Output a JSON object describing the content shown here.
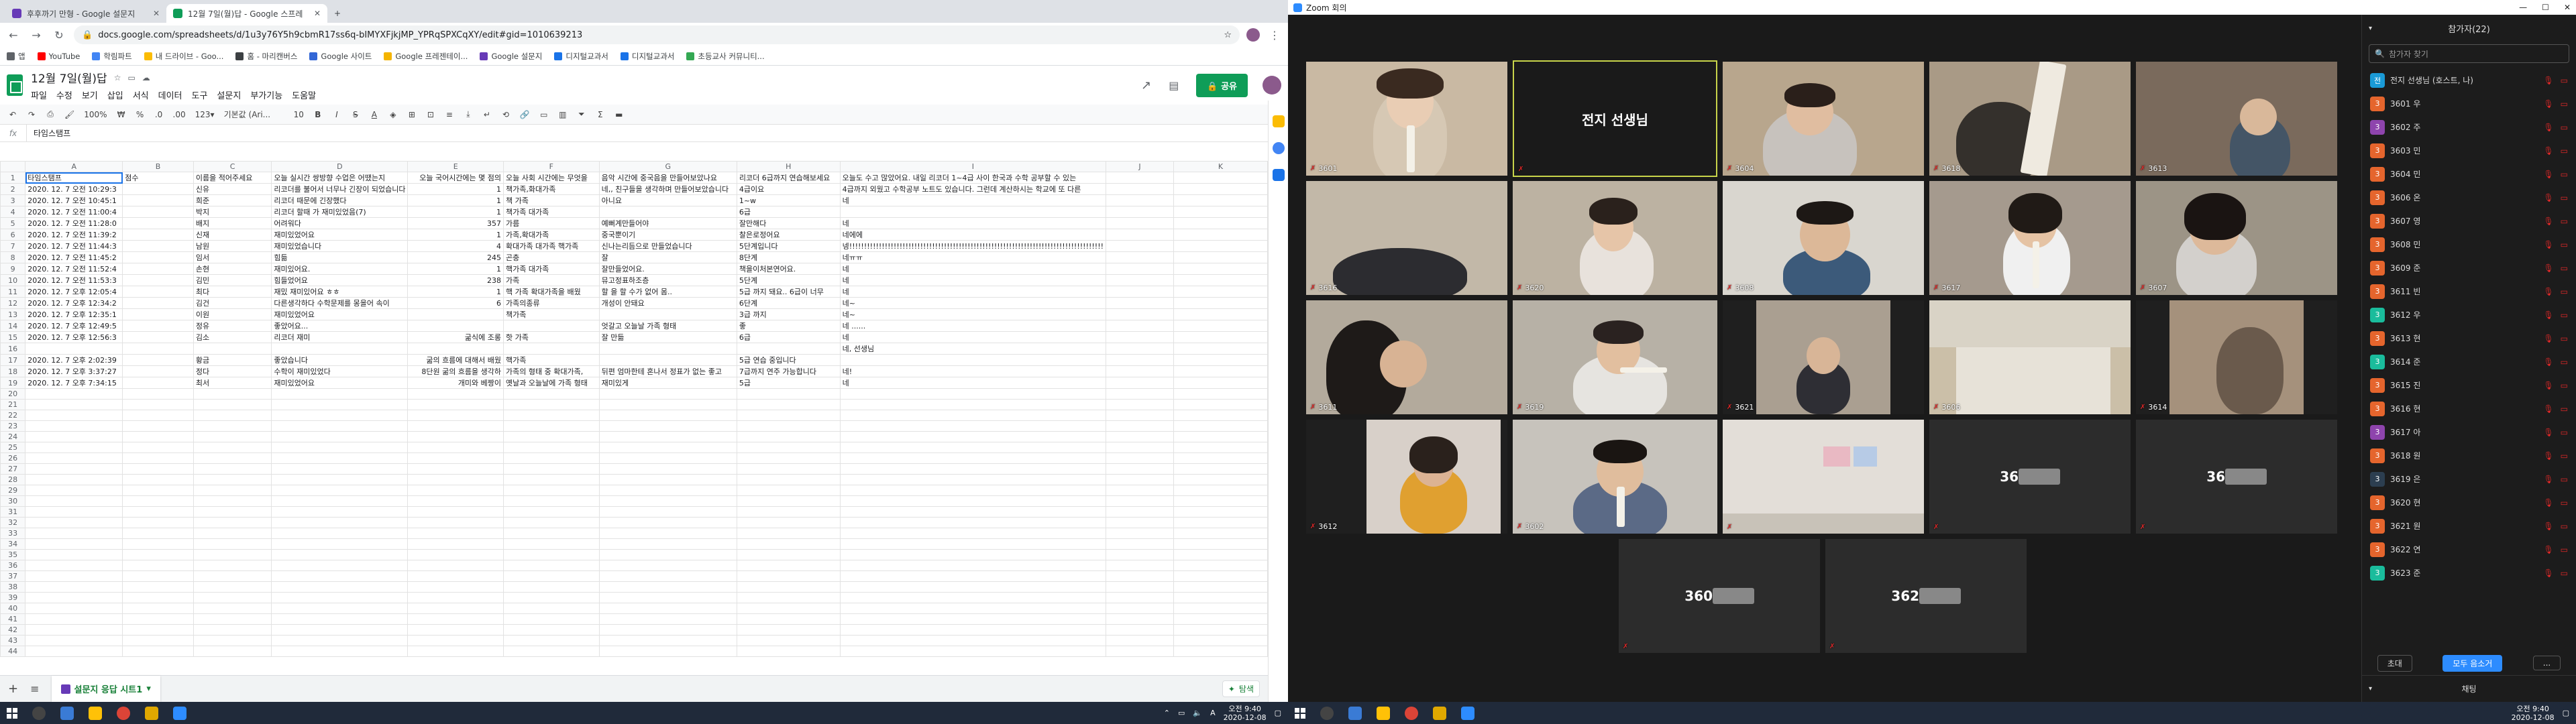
{
  "browser": {
    "tabs": [
      {
        "title": "후후까기 만형 - Google 설문지",
        "color": "#673ab7"
      },
      {
        "title": "12월 7일(월)답 - Google 스프레",
        "color": "#0f9d58"
      }
    ],
    "url": "docs.google.com/spreadsheets/d/1u3y76Y5h9cbmR17ss6q-bIMYXFjkjMP_YPRqSPXCqXY/edit#gid=1010639213",
    "bookmarks": [
      "앱",
      "YouTube",
      "학림파트",
      "내 드라이브 - Goo...",
      "홈 - 마리캔버스",
      "Google 사이트",
      "Google 프레젠테이...",
      "Google 설문지",
      "디지털교과서",
      "디지털교과서",
      "초등교사 커뮤니티..."
    ]
  },
  "sheet": {
    "title": "12월 7일(월)답",
    "menus": [
      "파일",
      "수정",
      "보기",
      "삽입",
      "서식",
      "데이터",
      "도구",
      "설문지",
      "부가기능",
      "도움말"
    ],
    "share_label": "공유",
    "toolbar": {
      "zoom": "100%",
      "format_pct": "%",
      "format_0": ".0",
      "format_00": ".00",
      "format_123": "123▾",
      "font": "기본값 (Ari...",
      "font_size": "10"
    },
    "formula_label": "fx",
    "formula_value": "타임스탬프",
    "columns": [
      "A",
      "B",
      "C",
      "D",
      "E",
      "F",
      "G",
      "H",
      "I",
      "J",
      "K"
    ],
    "rows": [
      {
        "n": "1",
        "c": [
          "타임스탬프",
          "점수",
          "이름을 적어주세요",
          "오늘 실시간 쌍방향 수업은 어땠는지",
          "오늘 국어시간에는 몇 점의",
          "오늘 사회 시간에는 무엇을",
          "음악 시간에 중국음을 만들어보았나요",
          "리코더 6급까지 연습해보세요",
          "오늘도 수고 많았어요. 내일 리코더 1~4급 사이 한국과 수학 공부할 수 있는",
          "",
          ""
        ]
      },
      {
        "n": "2",
        "c": [
          "2020. 12. 7 오전 10:29:3",
          "",
          "신유",
          "리코더를 불어서 너무나 긴장이 되었습니다",
          "1",
          "책가족,화대가족",
          "네,, 친구들을 생각하며 만들어보았습니다",
          "4급이요",
          "4급까지 외웠고 수학공부 노트도 있습니다. 그런데 계산하시는 학교에 또 다른",
          "",
          ""
        ]
      },
      {
        "n": "3",
        "c": [
          "2020. 12. 7 오전 10:45:1",
          "",
          "희준",
          "리코더 때문에 긴장했다",
          "1",
          "책 가족",
          "아니요",
          "1~w",
          "네",
          "",
          ""
        ]
      },
      {
        "n": "4",
        "c": [
          "2020. 12. 7 오전 11:00:4",
          "",
          "박지",
          "리코더 할때 가 재미있었음(7)",
          "1",
          "책가족 대가족",
          "",
          "6급",
          "",
          "",
          ""
        ]
      },
      {
        "n": "5",
        "c": [
          "2020. 12. 7 오전 11:28:0",
          "",
          "배지",
          "어려워다",
          "357",
          "가름",
          "예뻐계만들어야",
          "잘만해다",
          "네",
          "",
          ""
        ]
      },
      {
        "n": "6",
        "c": [
          "2020. 12. 7 오전 11:39:2",
          "",
          "신재",
          "재미있었어요",
          "1",
          "가족,확대가족",
          "중국뿐이기",
          "찰은로정어요",
          "네에에",
          "",
          ""
        ]
      },
      {
        "n": "7",
        "c": [
          "2020. 12. 7 오전 11:44:3",
          "",
          "남원",
          "재미있었습니다",
          "4",
          "확대가족 대가족 핵가족",
          "신나는리듬으로 만들었습니다",
          "5단계입니다",
          "넹!!!!!!!!!!!!!!!!!!!!!!!!!!!!!!!!!!!!!!!!!!!!!!!!!!!!!!!!!!!!!!!!!!!!!!!!!!!!!!!!!!!!!!",
          "",
          ""
        ]
      },
      {
        "n": "8",
        "c": [
          "2020. 12. 7 오전 11:45:2",
          "",
          "임서",
          "힘듦",
          "245",
          "곤충",
          "잘",
          "8단계",
          "네ㅠㅠ",
          "",
          ""
        ]
      },
      {
        "n": "9",
        "c": [
          "2020. 12. 7 오전 11:52:4",
          "",
          "손현",
          "재미있어요.",
          "1",
          "핵가족 대가족",
          "잘만들었어요.",
          "책을이처본연어요.",
          "네",
          "",
          ""
        ]
      },
      {
        "n": "10",
        "c": [
          "2020. 12. 7 오전 11:53:3",
          "",
          "김민",
          "힘들었어요",
          "238",
          "가족",
          "뮤고정표하조층",
          "5단계",
          "네",
          "",
          ""
        ]
      },
      {
        "n": "11",
        "c": [
          "2020. 12. 7 오후 12:05:4",
          "",
          "최다",
          "재밌 재미있어요 ㅎㅎ",
          "1",
          "핵 가족 확대가족을 배웠",
          "할 을 할 수가 없어 몸..",
          "5급 까지 돼요.. 6급이 너무",
          "네",
          "",
          ""
        ]
      },
      {
        "n": "12",
        "c": [
          "2020. 12. 7 오후 12:34:2",
          "",
          "김건",
          "다른생각하다 수학문제를 몽을어 속이",
          "6",
          "가족의종류",
          "개성이 안돼요",
          "6단계",
          "네~",
          "",
          ""
        ]
      },
      {
        "n": "13",
        "c": [
          "2020. 12. 7 오후 12:35:1",
          "",
          "이원",
          "재미있었어요",
          "",
          "책가족",
          "",
          "3급 까지",
          "네~",
          "",
          ""
        ]
      },
      {
        "n": "14",
        "c": [
          "2020. 12. 7 오후 12:49:5",
          "",
          "정유",
          "좋았어요...",
          "",
          "",
          "엇갈고 오늘날 가족 형태",
          "좋",
          "네 ......",
          "",
          ""
        ]
      },
      {
        "n": "15",
        "c": [
          "2020. 12. 7 오후 12:56:3",
          "",
          "김소",
          "리코더 재미",
          "굶식에 조롱",
          "핫 가족",
          "잘 만듦",
          "6급",
          "네",
          "",
          ""
        ]
      },
      {
        "n": "16",
        "c": [
          "",
          "",
          "",
          "",
          "",
          "",
          "",
          "",
          "네, 선생님",
          "",
          ""
        ]
      },
      {
        "n": "17",
        "c": [
          "2020. 12. 7 오후 2:02:39",
          "",
          "황금",
          "좋았습니다",
          "굶의 흐름에 대해서 배웠",
          "핵가족",
          "",
          "5급 연습 중입니다",
          "",
          "",
          ""
        ]
      },
      {
        "n": "18",
        "c": [
          "2020. 12. 7 오후 3:37:27",
          "",
          "정다",
          "수학이 재미있었다",
          "8단원 굶의 흐름을 생각하",
          "가족의 형태 중 확대가족,",
          "뒤편 엄마한테 혼나서 정표가 없는 좋고",
          "7급까지 연주 가능합니다",
          "네!",
          "",
          ""
        ]
      },
      {
        "n": "19",
        "c": [
          "2020. 12. 7 오후 7:34:15",
          "",
          "최서",
          "재미있었어요",
          "개미와 베짱이",
          "옛날과 오늘날에 가족 형태",
          "재미있게",
          "5급",
          "네",
          "",
          ""
        ]
      }
    ],
    "empty_rows": [
      "20",
      "21",
      "22",
      "23",
      "24",
      "25",
      "26",
      "27",
      "28",
      "29",
      "30",
      "31",
      "32",
      "33",
      "34",
      "35",
      "36",
      "37",
      "38",
      "39",
      "40",
      "41",
      "42",
      "43",
      "44"
    ],
    "add_sheet": "+",
    "all_sheets": "≡",
    "active_sheet_tab": "설문지 응답 시트1",
    "explore_label": "탐색"
  },
  "zoom": {
    "window_title": "Zoom 회의",
    "participants_header": "참가자(22)",
    "search_placeholder": "참가자 찾기",
    "host_tile_name": "전지 선생님",
    "tiles": [
      {
        "label": "3601",
        "bg": "#c9b9a3"
      },
      {
        "label": "",
        "bg": "#1a1a1a"
      },
      {
        "label": "3604",
        "bg": "#b8a68d"
      },
      {
        "label": "3618",
        "bg": "#a99a86"
      },
      {
        "label": "3613",
        "bg": "#7a6a5c"
      },
      {
        "label": "3616",
        "bg": "#c2b8a8"
      },
      {
        "label": "3620",
        "bg": "#bcb2a2"
      },
      {
        "label": "3608",
        "bg": "#d9d6cf"
      },
      {
        "label": "3617",
        "bg": "#a59a8e"
      },
      {
        "label": "3607",
        "bg": "#9c9486"
      },
      {
        "label": "3611",
        "bg": "#b3aa9c"
      },
      {
        "label": "3619",
        "bg": "#b7b1a6"
      },
      {
        "label": "3621",
        "bg": "#aa9f91"
      },
      {
        "label": "3606",
        "bg": "#cbbfa8"
      },
      {
        "label": "3614",
        "bg": "#a5917c"
      },
      {
        "label": "3612",
        "bg": "#d8d0c9"
      },
      {
        "label": "3602",
        "bg": "#c7c3bc"
      }
    ],
    "name_only_tiles": [
      "36",
      "36",
      "360",
      "362"
    ],
    "participants": [
      {
        "avatar": "전",
        "name": "전지 선생님 (호스트, 나)",
        "color": "#1a9ad6"
      },
      {
        "avatar": "3",
        "name": "3601 우",
        "color": "#e5652d"
      },
      {
        "avatar": "3",
        "name": "3602 주",
        "color": "#8e44ad"
      },
      {
        "avatar": "3",
        "name": "3603 민",
        "color": "#e5652d"
      },
      {
        "avatar": "3",
        "name": "3604 민",
        "color": "#e5652d"
      },
      {
        "avatar": "3",
        "name": "3606 온",
        "color": "#e5652d"
      },
      {
        "avatar": "3",
        "name": "3607 영",
        "color": "#e5652d"
      },
      {
        "avatar": "3",
        "name": "3608 민",
        "color": "#e5652d"
      },
      {
        "avatar": "3",
        "name": "3609 준",
        "color": "#e5652d"
      },
      {
        "avatar": "3",
        "name": "3611 빈",
        "color": "#e5652d"
      },
      {
        "avatar": "3",
        "name": "3612 우",
        "color": "#1abc9c"
      },
      {
        "avatar": "3",
        "name": "3613 현",
        "color": "#e5652d"
      },
      {
        "avatar": "3",
        "name": "3614 준",
        "color": "#1abc9c"
      },
      {
        "avatar": "3",
        "name": "3615 진",
        "color": "#e5652d"
      },
      {
        "avatar": "3",
        "name": "3616 현",
        "color": "#e5652d"
      },
      {
        "avatar": "3",
        "name": "3617 아",
        "color": "#8e44ad"
      },
      {
        "avatar": "3",
        "name": "3618 원",
        "color": "#e5652d"
      },
      {
        "avatar": "3",
        "name": "3619 은",
        "color": "#2c3e50"
      },
      {
        "avatar": "3",
        "name": "3620 현",
        "color": "#e5652d"
      },
      {
        "avatar": "3",
        "name": "3621 원",
        "color": "#e5652d"
      },
      {
        "avatar": "3",
        "name": "3622 연",
        "color": "#e5652d"
      },
      {
        "avatar": "3",
        "name": "3623 준",
        "color": "#1abc9c"
      }
    ],
    "invite_label": "초대",
    "mute_all_label": "모두 음소거",
    "more_label": "...",
    "chat_label": "채팅"
  },
  "taskbar_left": {
    "lang": "A",
    "time": "오전 9:40",
    "date": "2020-12-08"
  },
  "taskbar_right": {
    "time": "오전 9:40",
    "date": "2020-12-08"
  }
}
